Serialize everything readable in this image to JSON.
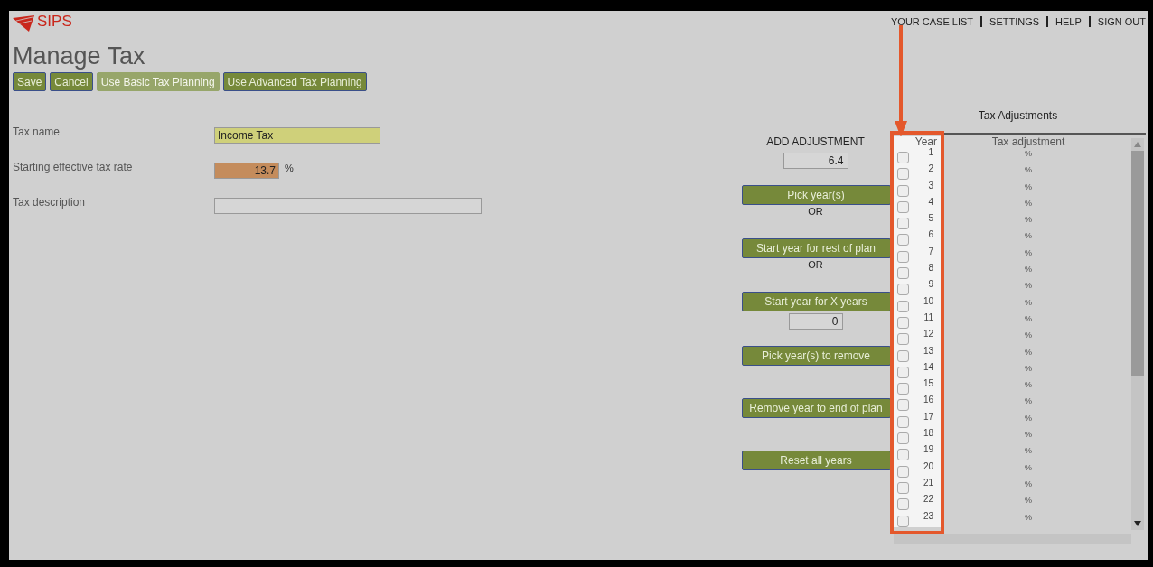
{
  "logo": {
    "title": "SIPS"
  },
  "nav": [
    "YOUR CASE LIST",
    "SETTINGS",
    "HELP",
    "SIGN OUT"
  ],
  "page_title": "Manage Tax",
  "toolbar": [
    {
      "label": "Save",
      "disabled": false
    },
    {
      "label": "Cancel",
      "disabled": false
    },
    {
      "label": "Use Basic Tax Planning",
      "disabled": true
    },
    {
      "label": "Use Advanced Tax Planning",
      "disabled": false
    }
  ],
  "form": [
    {
      "label": "Tax name",
      "value": "Income Tax",
      "color": "#cfd07a",
      "kind": "text"
    },
    {
      "label": "Starting effective tax rate",
      "value": "13.7",
      "unit": "%",
      "color": "#c48c5c",
      "kind": "number"
    },
    {
      "label": "Tax description",
      "kind": "wide"
    }
  ],
  "adjust": {
    "heading": "ADD ADJUSTMENT",
    "value": "6.4",
    "items": [
      {
        "kind": "button",
        "label": "Pick year(s)"
      },
      {
        "kind": "text",
        "label": "OR"
      },
      {
        "kind": "button",
        "label": "Start year for rest of plan"
      },
      {
        "kind": "text",
        "label": "OR"
      },
      {
        "kind": "button",
        "label": "Start year for X years"
      },
      {
        "kind": "input",
        "value": "0"
      },
      {
        "kind": "button",
        "label": "Pick year(s) to remove"
      },
      {
        "kind": "button",
        "label": "Remove year to end of plan"
      },
      {
        "kind": "button",
        "label": "Reset all years"
      }
    ]
  },
  "table": {
    "title": "Tax Adjustments",
    "columns": [
      "Year",
      "Tax adjustment"
    ],
    "rows": [
      {
        "year": "1",
        "unit": "%",
        "checked": false
      },
      {
        "year": "2",
        "unit": "%",
        "checked": false
      },
      {
        "year": "3",
        "unit": "%",
        "checked": false
      },
      {
        "year": "4",
        "unit": "%",
        "checked": false
      },
      {
        "year": "5",
        "unit": "%",
        "checked": false
      },
      {
        "year": "6",
        "unit": "%",
        "checked": false
      },
      {
        "year": "7",
        "unit": "%",
        "checked": false
      },
      {
        "year": "8",
        "unit": "%",
        "checked": false
      },
      {
        "year": "9",
        "unit": "%",
        "checked": false
      },
      {
        "year": "10",
        "unit": "%",
        "checked": false
      },
      {
        "year": "11",
        "unit": "%",
        "checked": false
      },
      {
        "year": "12",
        "unit": "%",
        "checked": false
      },
      {
        "year": "13",
        "unit": "%",
        "checked": false
      },
      {
        "year": "14",
        "unit": "%",
        "checked": false
      },
      {
        "year": "15",
        "unit": "%",
        "checked": false
      },
      {
        "year": "16",
        "unit": "%",
        "checked": false
      },
      {
        "year": "17",
        "unit": "%",
        "checked": false
      },
      {
        "year": "18",
        "unit": "%",
        "checked": false
      },
      {
        "year": "19",
        "unit": "%",
        "checked": false
      },
      {
        "year": "20",
        "unit": "%",
        "checked": false
      },
      {
        "year": "21",
        "unit": "%",
        "checked": false
      },
      {
        "year": "22",
        "unit": "%",
        "checked": false
      },
      {
        "year": "23",
        "unit": "%",
        "checked": false
      }
    ]
  }
}
